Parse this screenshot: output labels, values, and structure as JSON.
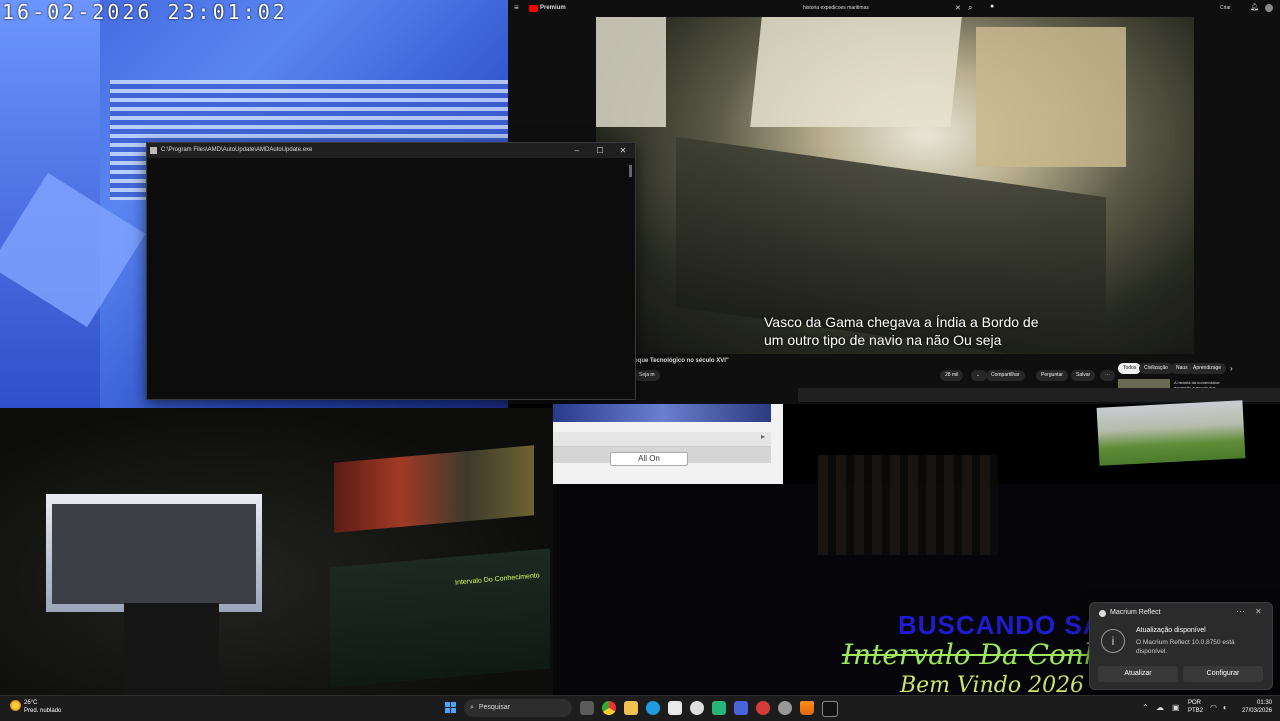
{
  "camera": {
    "timestamp": "16-02-2026  23:01:02"
  },
  "youtube": {
    "logo": "Premium",
    "search_query": "historia expedicoes maritimas",
    "create_label": "Criar",
    "subtitle_line1": "Vasco da Gama chegava a Índia a Bordo de",
    "subtitle_line2": "um outro tipo de navio na não Ou seja",
    "video_title": "oque Tecnológico no século XVI\"",
    "likes": "28 mil",
    "share": "Compartilhar",
    "ask": "Perguntar",
    "save": "Salvar",
    "join": "Seja m",
    "chips": [
      "Todos",
      "Civilização",
      "Naus",
      "Aprendizage"
    ],
    "rec_title": "A história da nomenclatur: expansão a mundo dos"
  },
  "console": {
    "title": "C:\\Program Files\\AMD\\AutoUpdate\\AMDAutoUpdate.exe"
  },
  "allon": {
    "button": "All On"
  },
  "room": {
    "screen_text": "Intervalo Do Conhecimento"
  },
  "overlays": {
    "line1": "BUSCANDO SA",
    "line2": "Intervalo Da Conh",
    "line3": "Bem Vindo 2026"
  },
  "toast": {
    "app": "Macrium Reflect",
    "heading": "Atualização disponível",
    "body": "O Macrium Reflect 10.0.8750 está disponível.",
    "button_update": "Atualizar",
    "button_configure": "Configurar"
  },
  "taskbar": {
    "temperature": "26°C",
    "weather": "Pred. nublado",
    "search_placeholder": "Pesquisar",
    "lang1": "POR",
    "lang2": "PTB2",
    "time": "01:30",
    "date": "27/03/2026"
  },
  "colors": {
    "accent": "#4aa3ff",
    "yt_red": "#ff0000",
    "toast_bg": "#2b2b2b"
  }
}
